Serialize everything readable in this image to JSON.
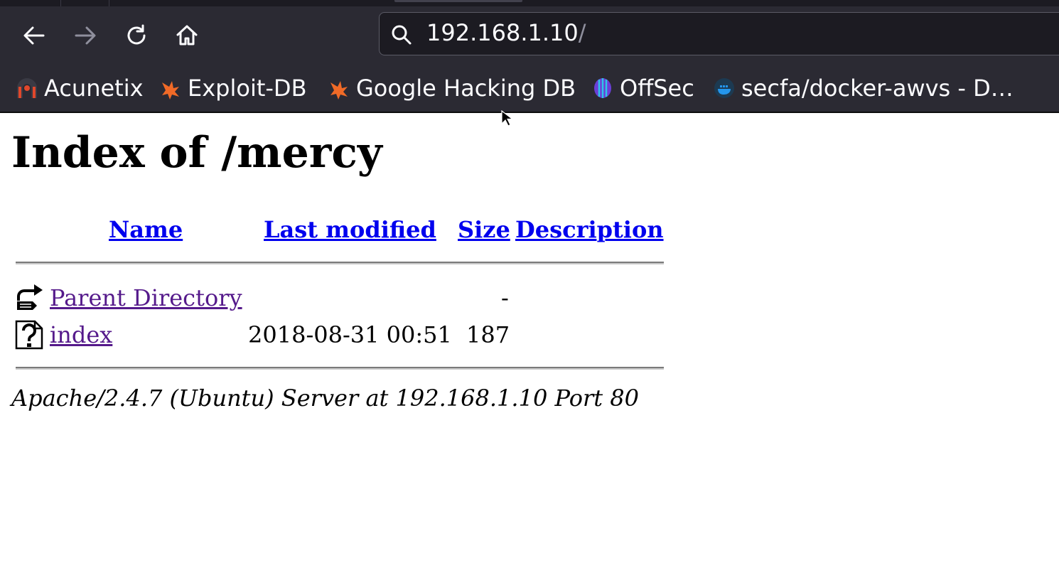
{
  "browser": {
    "url": "192.168.1.10",
    "url_trailing": "/",
    "nav": {
      "back_icon": "arrow-left-icon",
      "forward_icon": "arrow-right-icon",
      "reload_icon": "reload-icon",
      "home_icon": "home-icon"
    },
    "bookmarks": [
      {
        "label": "Acunetix",
        "icon": "acunetix-icon"
      },
      {
        "label": "Exploit-DB",
        "icon": "exploit-db-icon"
      },
      {
        "label": "Google Hacking DB",
        "icon": "ghdb-icon"
      },
      {
        "label": "OffSec",
        "icon": "offsec-icon"
      },
      {
        "label": "secfa/docker-awvs - D…",
        "icon": "docker-icon"
      }
    ],
    "colors": {
      "chrome_bg": "#2b2a33",
      "url_bg": "#1c1b22",
      "text": "#fbfbfe"
    }
  },
  "page": {
    "title": "Index of /mercy",
    "columns": {
      "name": "Name",
      "last_modified": "Last modified",
      "size": "Size",
      "description": "Description"
    },
    "rows": [
      {
        "name": "Parent Directory",
        "modified": "",
        "size": "-",
        "icon": "parent-directory-icon"
      },
      {
        "name": "index",
        "modified": "2018-08-31 00:51",
        "size": "187",
        "icon": "unknown-file-icon"
      }
    ],
    "footer": "Apache/2.4.7 (Ubuntu) Server at 192.168.1.10 Port 80",
    "colors": {
      "link": "#0000ee",
      "visited": "#551a8b"
    }
  }
}
